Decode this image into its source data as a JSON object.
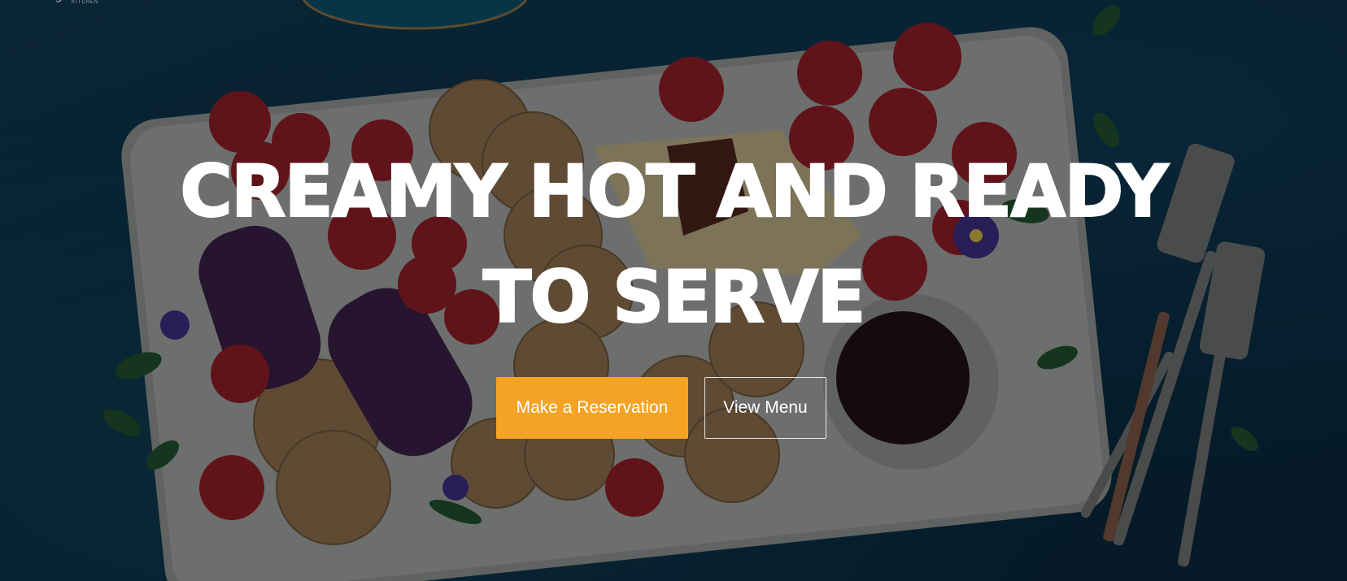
{
  "brand": {
    "logo_script": "y",
    "logo_sub": "KITCHEN"
  },
  "hero": {
    "headline_line1": "CREAMY HOT AND READY",
    "headline_line2": "TO SERVE",
    "primary_cta": "Make a Reservation",
    "secondary_cta": "View Menu"
  },
  "colors": {
    "accent": "#f5a324",
    "background": "#0b2a3a",
    "text": "#ffffff"
  }
}
